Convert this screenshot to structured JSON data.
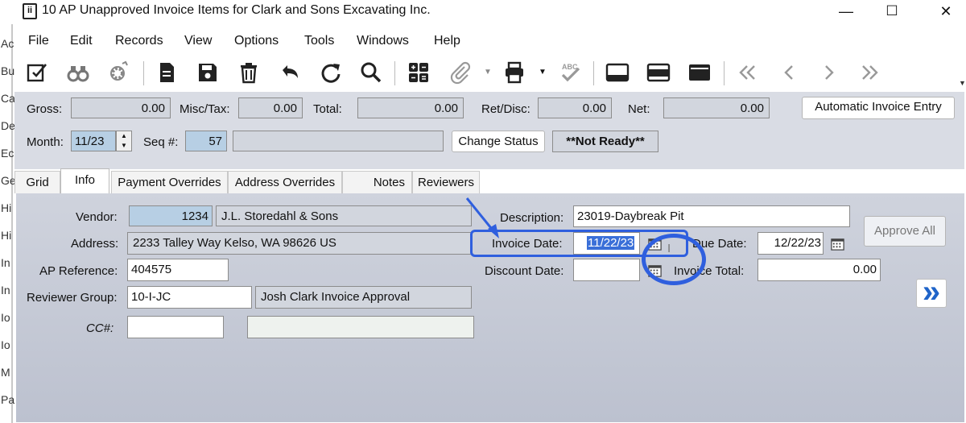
{
  "window": {
    "title": "10 AP Unapproved Invoice Items for Clark and Sons Excavating Inc.",
    "app_icon_glyph": "ii",
    "minimize": "—",
    "maximize": "☐",
    "close": "✕"
  },
  "background_letters": [
    "Ac",
    "Bu",
    "Ca",
    "De",
    "Ec",
    "Ge",
    "Hi",
    "Hi",
    "In",
    "In",
    "Io",
    "Io",
    "M",
    "Pa"
  ],
  "menu": [
    "File",
    "Edit",
    "Records",
    "View",
    "Options",
    "Tools",
    "Windows",
    "Help"
  ],
  "toolbar": {
    "icons": [
      "edit-icon",
      "binoculars-icon",
      "gear-icon",
      "document-icon",
      "save-icon",
      "delete-icon",
      "undo-icon",
      "redo-icon",
      "search-icon",
      "calculator-icon",
      "attach-icon",
      "print-icon",
      "spellcheck-icon",
      "layout-bottom-icon",
      "layout-middle-icon",
      "layout-top-icon",
      "first-record-icon",
      "previous-record-icon",
      "next-record-icon",
      "last-record-icon"
    ]
  },
  "header": {
    "gross_label": "Gross:",
    "gross_value": "0.00",
    "misc_label": "Misc/Tax:",
    "misc_value": "0.00",
    "total_label": "Total:",
    "total_value": "0.00",
    "retdisc_label": "Ret/Disc:",
    "retdisc_value": "0.00",
    "net_label": "Net:",
    "net_value": "0.00",
    "auto_invoice_button": "Automatic Invoice Entry",
    "month_label": "Month:",
    "month_value": "11/23",
    "seq_label": "Seq #:",
    "seq_value": "57",
    "seq_desc": "",
    "change_status_button": "Change Status",
    "status_text": "**Not Ready**"
  },
  "tabs": [
    "Grid",
    "Info",
    "Payment Overrides",
    "Address Overrides",
    "Notes",
    "Reviewers"
  ],
  "active_tab": "Info",
  "form": {
    "vendor_label": "Vendor:",
    "vendor_number": "1234",
    "vendor_name": "J.L. Storedahl & Sons",
    "address_label": "Address:",
    "address_value": "2233 Talley Way  Kelso, WA  98626  US",
    "ap_reference_label": "AP Reference:",
    "ap_reference_value": "404575",
    "reviewer_group_label": "Reviewer Group:",
    "reviewer_group_value": "10-I-JC",
    "reviewer_group_desc": "Josh Clark Invoice Approval",
    "cc_label": "CC#:",
    "cc_value": "",
    "cc_desc": "",
    "description_label": "Description:",
    "description_value": "23019-Daybreak Pit",
    "invoice_date_label": "Invoice Date:",
    "invoice_date_value": "11/22/23",
    "due_date_label": "Due Date:",
    "due_date_value": "12/22/23",
    "discount_date_label": "Discount Date:",
    "discount_date_value": "",
    "invoice_total_label": "Invoice Total:",
    "invoice_total_value": "0.00",
    "approve_all_button": "Approve All",
    "next_button_glyph": "»"
  },
  "colors": {
    "annotation": "#2f5fde",
    "highlight_selection": "#3a6fd8",
    "next_button": "#1f64c9"
  }
}
